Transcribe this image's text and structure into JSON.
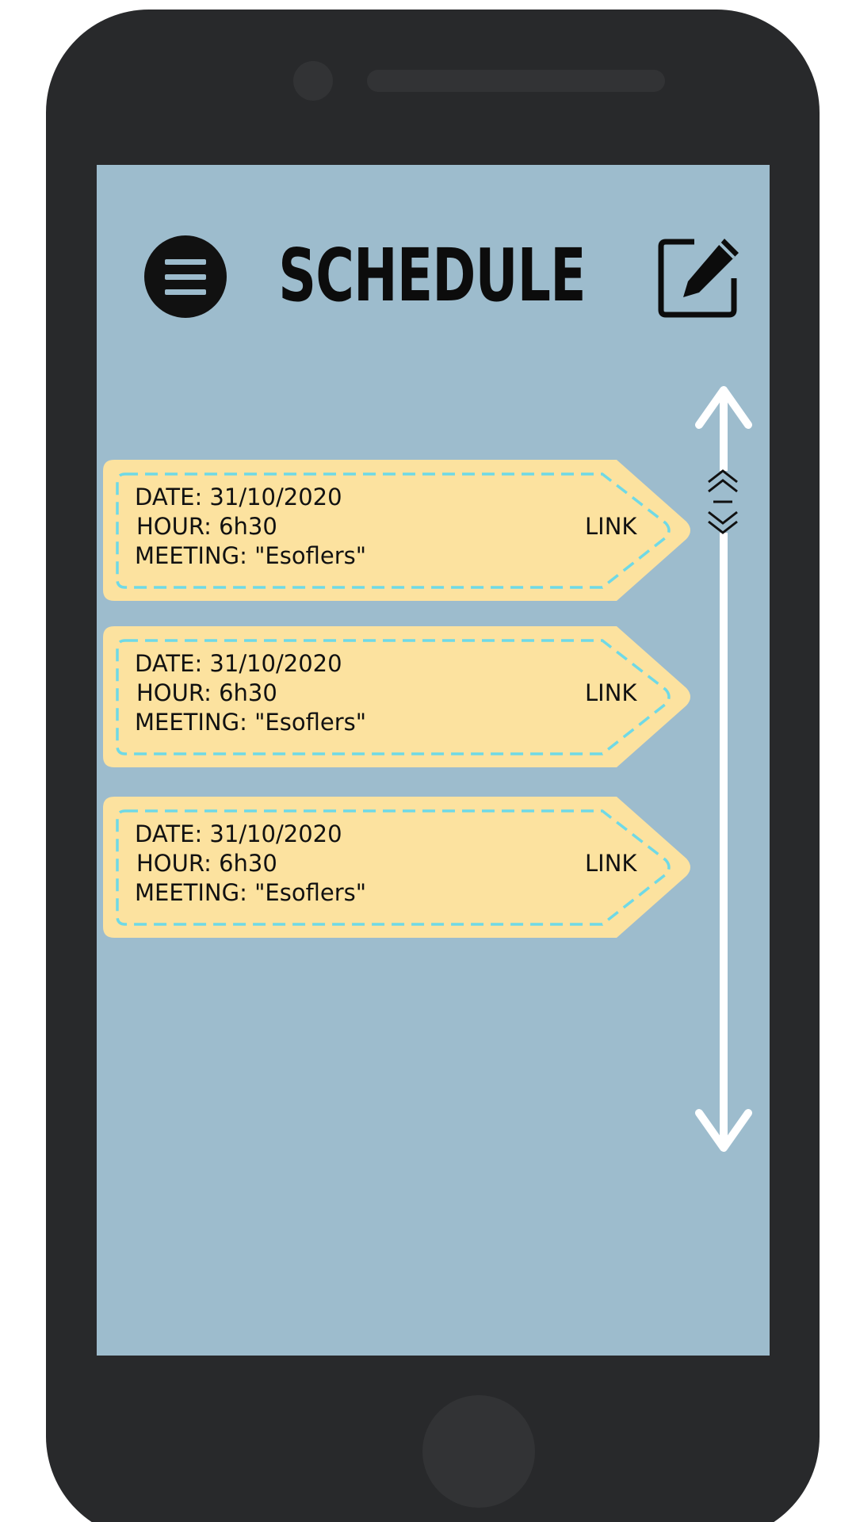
{
  "header": {
    "title": "SCHEDULE",
    "menu_icon": "hamburger-menu-icon",
    "edit_icon": "edit-square-pen-icon"
  },
  "scrollbar": {
    "up_icon": "arrow-up-icon",
    "down_icon": "arrow-down-icon",
    "handle_icon": "scroll-handle-chevrons-icon"
  },
  "meetings": [
    {
      "date": "DATE: 31/10/2020",
      "hour": "HOUR: 6h30",
      "meeting": "MEETING: \"Esoflers\"",
      "link": "LINK"
    },
    {
      "date": "DATE: 31/10/2020",
      "hour": "HOUR: 6h30",
      "meeting": "MEETING: \"Esoflers\"",
      "link": "LINK"
    },
    {
      "date": "DATE: 31/10/2020",
      "hour": "HOUR: 6h30",
      "meeting": "MEETING: \"Esoflers\"",
      "link": "LINK"
    }
  ],
  "colors": {
    "phone_body": "#28292b",
    "screen": "#9dbccd",
    "card_fill": "#fce29f",
    "card_dash": "#6fd9e6",
    "scroll": "#ffffff"
  }
}
